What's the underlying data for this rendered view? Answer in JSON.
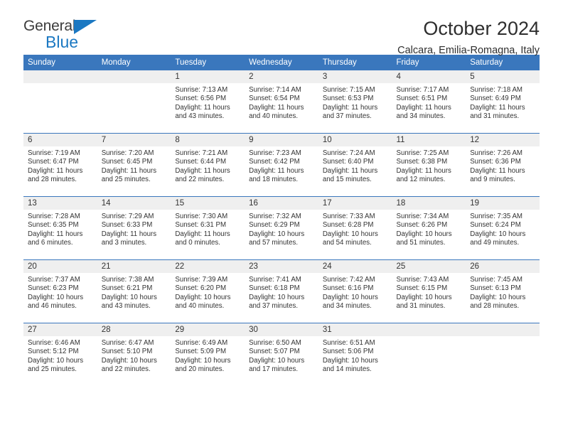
{
  "logo": {
    "word_top": "General",
    "word_bottom": "Blue",
    "triangle_color": "#1b78c2"
  },
  "header": {
    "title": "October 2024",
    "location": "Calcara, Emilia-Romagna, Italy"
  },
  "theme": {
    "header_blue": "#3a77bd",
    "daynum_gray": "#efefef",
    "text": "#333333"
  },
  "weekday_headers": [
    "Sunday",
    "Monday",
    "Tuesday",
    "Wednesday",
    "Thursday",
    "Friday",
    "Saturday"
  ],
  "weeks": [
    [
      {
        "day": "",
        "sunrise": "",
        "sunset": "",
        "daylight_line1": "",
        "daylight_line2": "",
        "empty": true
      },
      {
        "day": "",
        "sunrise": "",
        "sunset": "",
        "daylight_line1": "",
        "daylight_line2": "",
        "empty": true
      },
      {
        "day": "1",
        "sunrise": "Sunrise: 7:13 AM",
        "sunset": "Sunset: 6:56 PM",
        "daylight_line1": "Daylight: 11 hours",
        "daylight_line2": "and 43 minutes."
      },
      {
        "day": "2",
        "sunrise": "Sunrise: 7:14 AM",
        "sunset": "Sunset: 6:54 PM",
        "daylight_line1": "Daylight: 11 hours",
        "daylight_line2": "and 40 minutes."
      },
      {
        "day": "3",
        "sunrise": "Sunrise: 7:15 AM",
        "sunset": "Sunset: 6:53 PM",
        "daylight_line1": "Daylight: 11 hours",
        "daylight_line2": "and 37 minutes."
      },
      {
        "day": "4",
        "sunrise": "Sunrise: 7:17 AM",
        "sunset": "Sunset: 6:51 PM",
        "daylight_line1": "Daylight: 11 hours",
        "daylight_line2": "and 34 minutes."
      },
      {
        "day": "5",
        "sunrise": "Sunrise: 7:18 AM",
        "sunset": "Sunset: 6:49 PM",
        "daylight_line1": "Daylight: 11 hours",
        "daylight_line2": "and 31 minutes."
      }
    ],
    [
      {
        "day": "6",
        "sunrise": "Sunrise: 7:19 AM",
        "sunset": "Sunset: 6:47 PM",
        "daylight_line1": "Daylight: 11 hours",
        "daylight_line2": "and 28 minutes."
      },
      {
        "day": "7",
        "sunrise": "Sunrise: 7:20 AM",
        "sunset": "Sunset: 6:45 PM",
        "daylight_line1": "Daylight: 11 hours",
        "daylight_line2": "and 25 minutes."
      },
      {
        "day": "8",
        "sunrise": "Sunrise: 7:21 AM",
        "sunset": "Sunset: 6:44 PM",
        "daylight_line1": "Daylight: 11 hours",
        "daylight_line2": "and 22 minutes."
      },
      {
        "day": "9",
        "sunrise": "Sunrise: 7:23 AM",
        "sunset": "Sunset: 6:42 PM",
        "daylight_line1": "Daylight: 11 hours",
        "daylight_line2": "and 18 minutes."
      },
      {
        "day": "10",
        "sunrise": "Sunrise: 7:24 AM",
        "sunset": "Sunset: 6:40 PM",
        "daylight_line1": "Daylight: 11 hours",
        "daylight_line2": "and 15 minutes."
      },
      {
        "day": "11",
        "sunrise": "Sunrise: 7:25 AM",
        "sunset": "Sunset: 6:38 PM",
        "daylight_line1": "Daylight: 11 hours",
        "daylight_line2": "and 12 minutes."
      },
      {
        "day": "12",
        "sunrise": "Sunrise: 7:26 AM",
        "sunset": "Sunset: 6:36 PM",
        "daylight_line1": "Daylight: 11 hours",
        "daylight_line2": "and 9 minutes."
      }
    ],
    [
      {
        "day": "13",
        "sunrise": "Sunrise: 7:28 AM",
        "sunset": "Sunset: 6:35 PM",
        "daylight_line1": "Daylight: 11 hours",
        "daylight_line2": "and 6 minutes."
      },
      {
        "day": "14",
        "sunrise": "Sunrise: 7:29 AM",
        "sunset": "Sunset: 6:33 PM",
        "daylight_line1": "Daylight: 11 hours",
        "daylight_line2": "and 3 minutes."
      },
      {
        "day": "15",
        "sunrise": "Sunrise: 7:30 AM",
        "sunset": "Sunset: 6:31 PM",
        "daylight_line1": "Daylight: 11 hours",
        "daylight_line2": "and 0 minutes."
      },
      {
        "day": "16",
        "sunrise": "Sunrise: 7:32 AM",
        "sunset": "Sunset: 6:29 PM",
        "daylight_line1": "Daylight: 10 hours",
        "daylight_line2": "and 57 minutes."
      },
      {
        "day": "17",
        "sunrise": "Sunrise: 7:33 AM",
        "sunset": "Sunset: 6:28 PM",
        "daylight_line1": "Daylight: 10 hours",
        "daylight_line2": "and 54 minutes."
      },
      {
        "day": "18",
        "sunrise": "Sunrise: 7:34 AM",
        "sunset": "Sunset: 6:26 PM",
        "daylight_line1": "Daylight: 10 hours",
        "daylight_line2": "and 51 minutes."
      },
      {
        "day": "19",
        "sunrise": "Sunrise: 7:35 AM",
        "sunset": "Sunset: 6:24 PM",
        "daylight_line1": "Daylight: 10 hours",
        "daylight_line2": "and 49 minutes."
      }
    ],
    [
      {
        "day": "20",
        "sunrise": "Sunrise: 7:37 AM",
        "sunset": "Sunset: 6:23 PM",
        "daylight_line1": "Daylight: 10 hours",
        "daylight_line2": "and 46 minutes."
      },
      {
        "day": "21",
        "sunrise": "Sunrise: 7:38 AM",
        "sunset": "Sunset: 6:21 PM",
        "daylight_line1": "Daylight: 10 hours",
        "daylight_line2": "and 43 minutes."
      },
      {
        "day": "22",
        "sunrise": "Sunrise: 7:39 AM",
        "sunset": "Sunset: 6:20 PM",
        "daylight_line1": "Daylight: 10 hours",
        "daylight_line2": "and 40 minutes."
      },
      {
        "day": "23",
        "sunrise": "Sunrise: 7:41 AM",
        "sunset": "Sunset: 6:18 PM",
        "daylight_line1": "Daylight: 10 hours",
        "daylight_line2": "and 37 minutes."
      },
      {
        "day": "24",
        "sunrise": "Sunrise: 7:42 AM",
        "sunset": "Sunset: 6:16 PM",
        "daylight_line1": "Daylight: 10 hours",
        "daylight_line2": "and 34 minutes."
      },
      {
        "day": "25",
        "sunrise": "Sunrise: 7:43 AM",
        "sunset": "Sunset: 6:15 PM",
        "daylight_line1": "Daylight: 10 hours",
        "daylight_line2": "and 31 minutes."
      },
      {
        "day": "26",
        "sunrise": "Sunrise: 7:45 AM",
        "sunset": "Sunset: 6:13 PM",
        "daylight_line1": "Daylight: 10 hours",
        "daylight_line2": "and 28 minutes."
      }
    ],
    [
      {
        "day": "27",
        "sunrise": "Sunrise: 6:46 AM",
        "sunset": "Sunset: 5:12 PM",
        "daylight_line1": "Daylight: 10 hours",
        "daylight_line2": "and 25 minutes."
      },
      {
        "day": "28",
        "sunrise": "Sunrise: 6:47 AM",
        "sunset": "Sunset: 5:10 PM",
        "daylight_line1": "Daylight: 10 hours",
        "daylight_line2": "and 22 minutes."
      },
      {
        "day": "29",
        "sunrise": "Sunrise: 6:49 AM",
        "sunset": "Sunset: 5:09 PM",
        "daylight_line1": "Daylight: 10 hours",
        "daylight_line2": "and 20 minutes."
      },
      {
        "day": "30",
        "sunrise": "Sunrise: 6:50 AM",
        "sunset": "Sunset: 5:07 PM",
        "daylight_line1": "Daylight: 10 hours",
        "daylight_line2": "and 17 minutes."
      },
      {
        "day": "31",
        "sunrise": "Sunrise: 6:51 AM",
        "sunset": "Sunset: 5:06 PM",
        "daylight_line1": "Daylight: 10 hours",
        "daylight_line2": "and 14 minutes."
      },
      {
        "day": "",
        "sunrise": "",
        "sunset": "",
        "daylight_line1": "",
        "daylight_line2": "",
        "empty": true
      },
      {
        "day": "",
        "sunrise": "",
        "sunset": "",
        "daylight_line1": "",
        "daylight_line2": "",
        "empty": true
      }
    ]
  ]
}
